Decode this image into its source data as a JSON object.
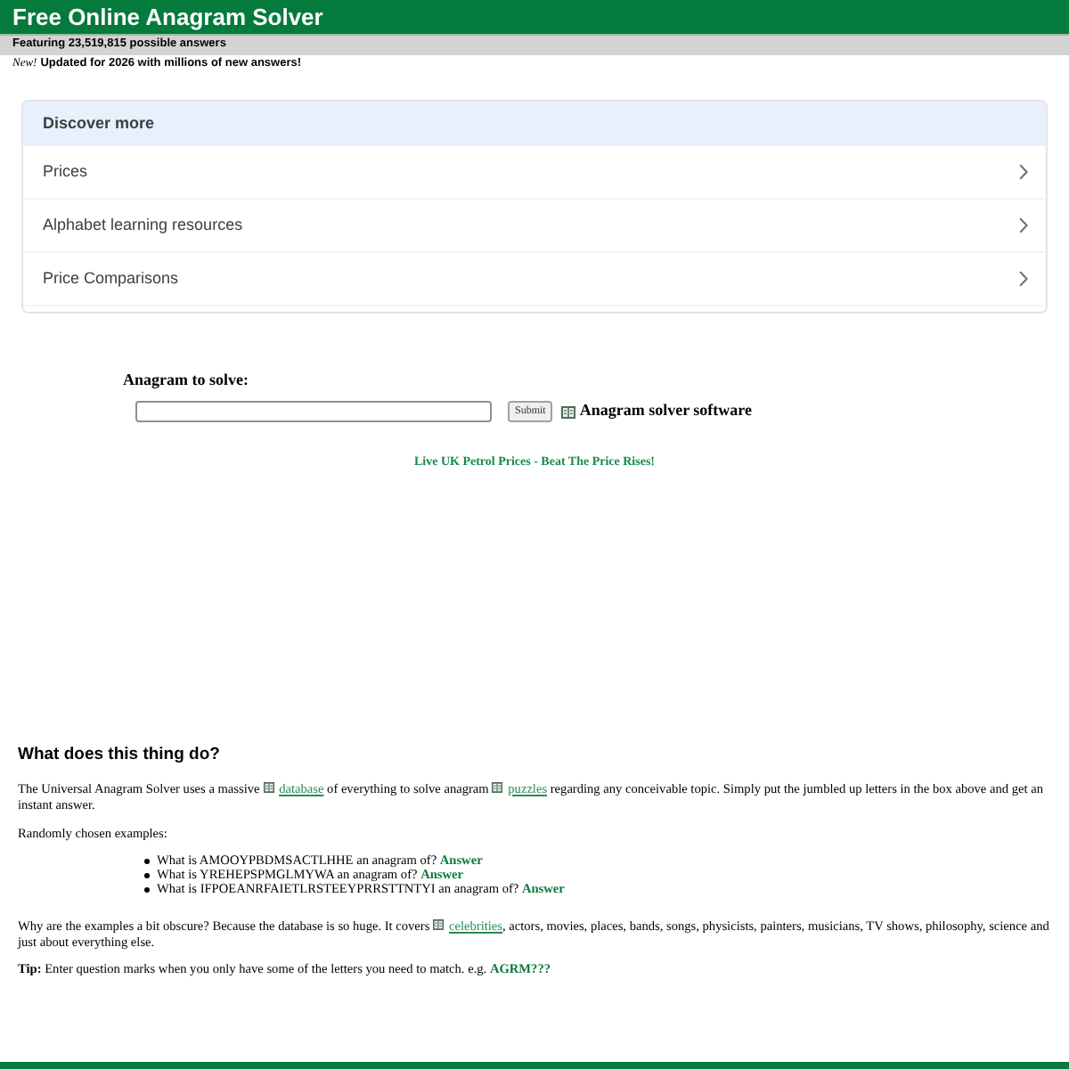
{
  "header": {
    "title": "Free Online Anagram Solver",
    "tagline": "Featuring 23,519,815 possible answers"
  },
  "notice": {
    "badge": "New!",
    "text": "Updated for 2026 with millions of new answers!"
  },
  "discover": {
    "title": "Discover more",
    "items": [
      "Prices",
      "Alphabet learning resources",
      "Price Comparisons"
    ]
  },
  "form": {
    "label": "Anagram to solve:",
    "button": "Submit",
    "software_link": "Anagram solver software"
  },
  "promo_link": "Live UK Petrol Prices - Beat The Price Rises!",
  "about": {
    "heading": "What does this thing do?",
    "intro": [
      {
        "kind": "text",
        "text": "The Universal Anagram Solver uses a massive "
      },
      {
        "kind": "link",
        "text": "database"
      },
      {
        "kind": "text",
        "text": " of everything to solve anagram "
      },
      {
        "kind": "link",
        "text": "puzzles"
      },
      {
        "kind": "text",
        "text": " regarding any conceivable topic. Simply put the jumbled up letters in the box above and get an instant answer."
      }
    ],
    "examples_label": "Randomly chosen examples:",
    "examples": [
      {
        "question": "What is AMOOYPBDMSACTLHHE an anagram of?",
        "link": "Answer"
      },
      {
        "question": "What is YREHEPSPMGLMYWA an anagram of?",
        "link": "Answer"
      },
      {
        "question": "What is IFPOEANRFAIETLRSTEEYPRRSTTNTYI an anagram of?",
        "link": "Answer"
      }
    ],
    "why": [
      {
        "kind": "text",
        "text": "Why are the examples a bit obscure? Because the database is so huge. It covers "
      },
      {
        "kind": "link",
        "text": "celebrities"
      },
      {
        "kind": "text",
        "text": ", actors, movies, places, bands, songs, physicists, painters, musicians, TV shows, philosophy, science and just about everything else."
      }
    ],
    "tip": {
      "text": "**Tip:** Enter question marks when you only have some of the letters you need to match. e.g.",
      "link": "AGRM???"
    }
  }
}
